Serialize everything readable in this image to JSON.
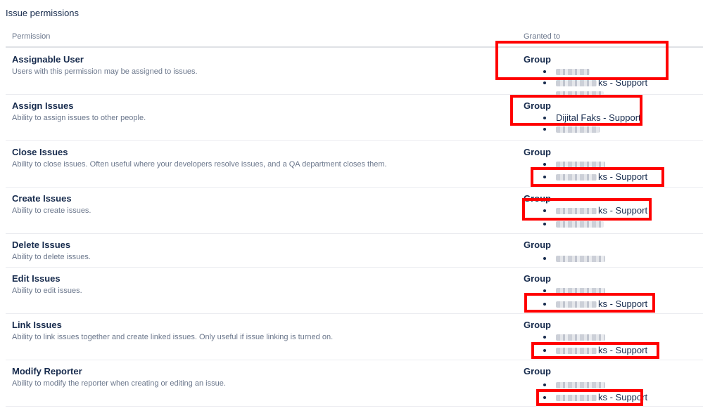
{
  "page": {
    "section_title": "Issue permissions",
    "columns": {
      "permission": "Permission",
      "granted_to": "Granted to"
    }
  },
  "colors": {
    "highlight": "#ff0000",
    "text_primary": "#172b4d",
    "text_secondary": "#6b778c",
    "divider": "#ebecf0"
  },
  "permissions": [
    {
      "name": "Assignable User",
      "description": "Users with this permission may be assigned to issues.",
      "grant_type": "Group",
      "items": [
        "",
        "ks - Support",
        ""
      ]
    },
    {
      "name": "Assign Issues",
      "description": "Ability to assign issues to other people.",
      "grant_type": "Group",
      "items": [
        "Dijital Faks - Support",
        ""
      ]
    },
    {
      "name": "Close Issues",
      "description": "Ability to close issues. Often useful where your developers resolve issues, and a QA department closes them.",
      "grant_type": "Group",
      "items": [
        "",
        "ks - Support"
      ]
    },
    {
      "name": "Create Issues",
      "description": "Ability to create issues.",
      "grant_type": "Group",
      "items": [
        "ks - Support",
        ""
      ]
    },
    {
      "name": "Delete Issues",
      "description": "Ability to delete issues.",
      "grant_type": "Group",
      "items": [
        ""
      ]
    },
    {
      "name": "Edit Issues",
      "description": "Ability to edit issues.",
      "grant_type": "Group",
      "items": [
        "",
        "ks - Support"
      ]
    },
    {
      "name": "Link Issues",
      "description": "Ability to link issues together and create linked issues. Only useful if issue linking is turned on.",
      "grant_type": "Group",
      "items": [
        "",
        "ks - Support"
      ]
    },
    {
      "name": "Modify Reporter",
      "description": "Ability to modify the reporter when creating or editing an issue.",
      "grant_type": "Group",
      "items": [
        "",
        "ks - Support"
      ]
    }
  ]
}
